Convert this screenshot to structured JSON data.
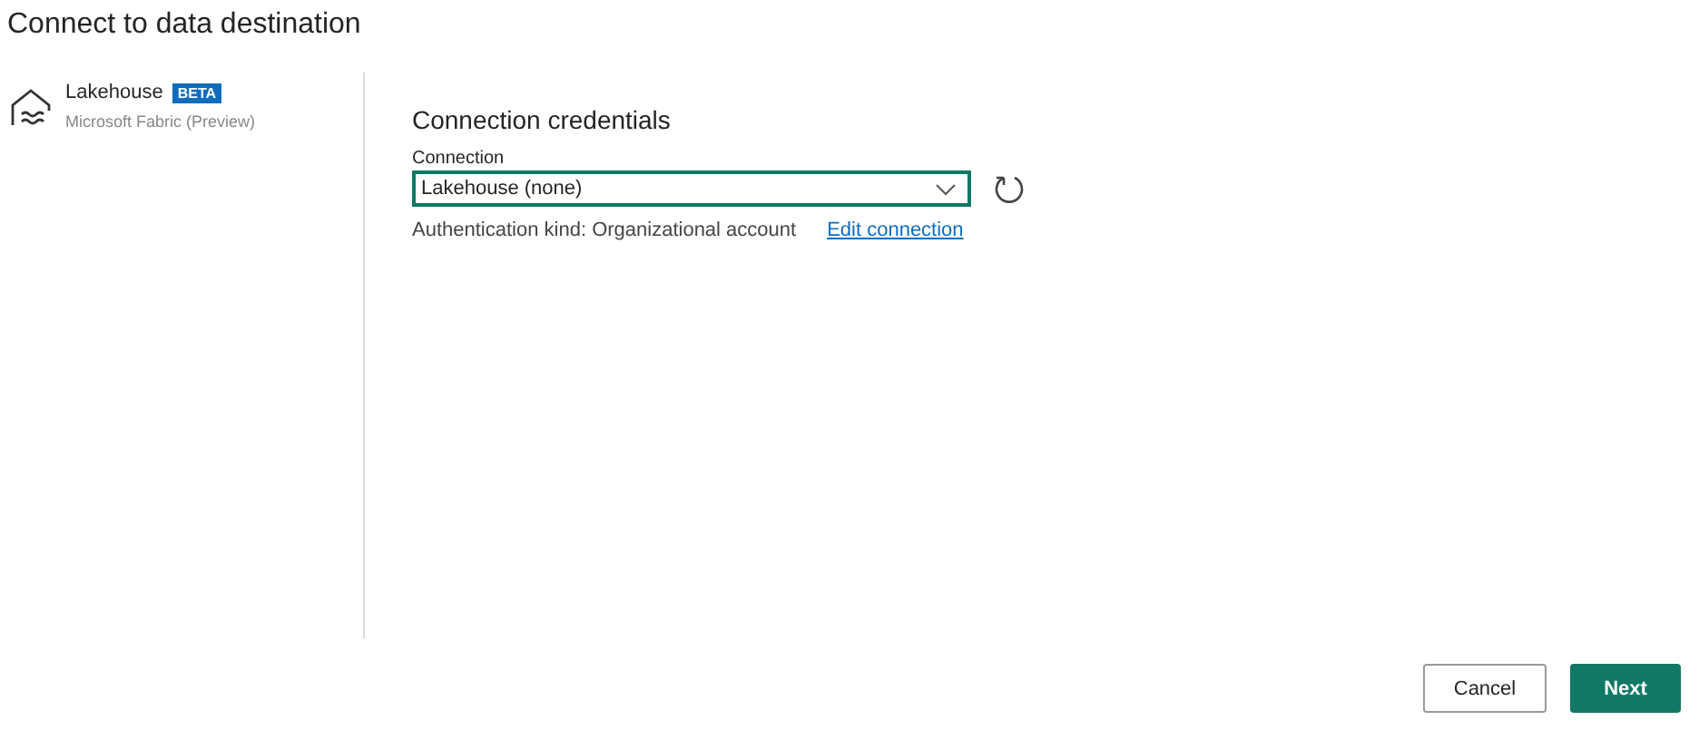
{
  "window": {
    "title": "Connect to data destination"
  },
  "sidebar": {
    "items": [
      {
        "name": "Lakehouse",
        "badge": "BETA",
        "subtitle": "Microsoft Fabric (Preview)",
        "selected": true
      }
    ]
  },
  "credentials": {
    "heading": "Connection credentials",
    "connection_label": "Connection",
    "connection_value": "Lakehouse (none)",
    "auth_text": "Authentication kind: Organizational account",
    "edit_link": "Edit connection"
  },
  "buttons": [
    {
      "label": "Cancel",
      "kind": "secondary"
    },
    {
      "label": "Next",
      "kind": "primary"
    }
  ]
}
